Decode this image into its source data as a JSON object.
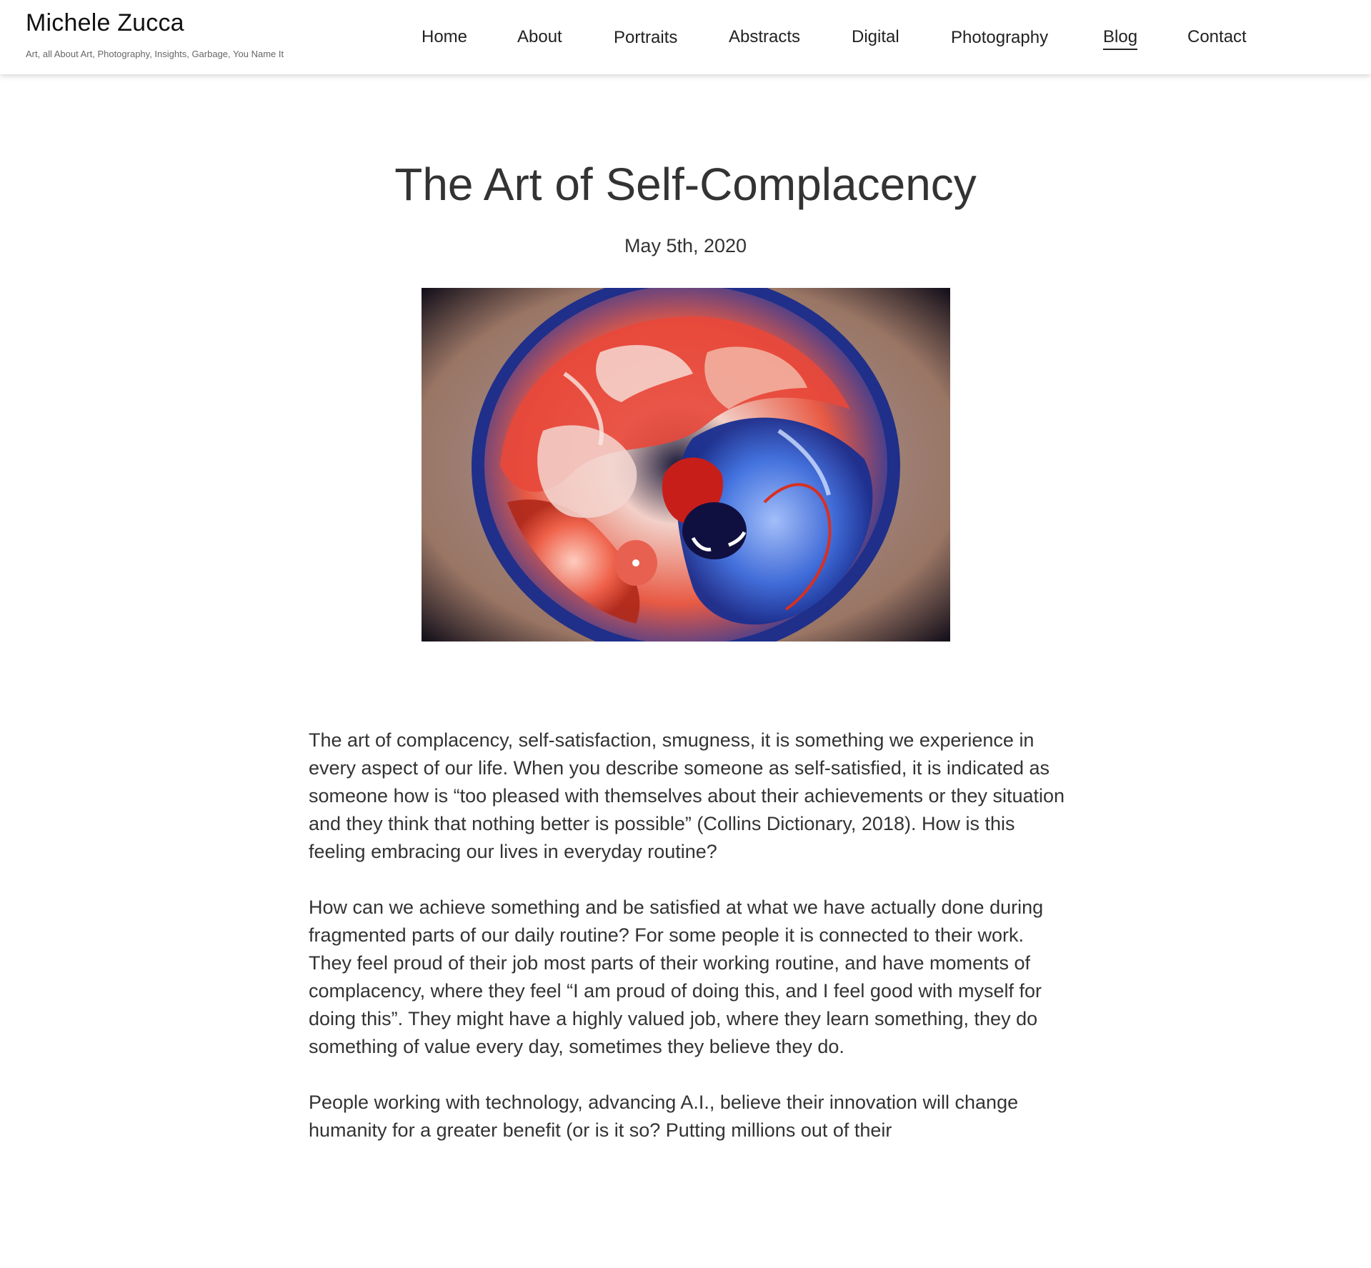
{
  "site": {
    "title": "Michele Zucca",
    "tagline": "Art, all About Art, Photography, Insights, Garbage, You Name It"
  },
  "nav": {
    "items": [
      {
        "label": "Home",
        "active": false
      },
      {
        "label": "About",
        "active": false
      },
      {
        "label": "Portraits",
        "active": false
      },
      {
        "label": "Abstracts",
        "active": false
      },
      {
        "label": "Digital",
        "active": false
      },
      {
        "label": "Photography",
        "active": false
      },
      {
        "label": "Blog",
        "active": true
      },
      {
        "label": "Contact",
        "active": false
      }
    ]
  },
  "post": {
    "title": "The Art of Self-Complacency",
    "date": "May 5th, 2020",
    "paragraphs": [
      "The art of complacency, self-satisfaction, smugness, it is something we experience in every aspect of our life. When you describe someone as self-satisfied, it is indicated as someone how is “too pleased with themselves about their achievements or they situation and they think that nothing better is possible” (Collins Dictionary, 2018). How is this feeling embracing our lives in everyday routine?",
      "How can we achieve something and be satisfied at what we have actually done during fragmented parts of our daily routine? For some people it is connected to their work. They feel proud of their job most parts of their working routine, and have moments of complacency, where they feel “I am proud of doing this, and I feel good with myself for doing this”. They might have a highly valued job, where they learn something, they do something of value every day, sometimes they believe they do.",
      "People working with technology, advancing A.I., believe their innovation will change humanity for a greater benefit (or is it so? Putting millions out of their"
    ]
  },
  "colors": {
    "text": "#333333",
    "header_bg": "#ffffff",
    "hero_red": "#e8483a",
    "hero_blue": "#2f5fd8"
  }
}
